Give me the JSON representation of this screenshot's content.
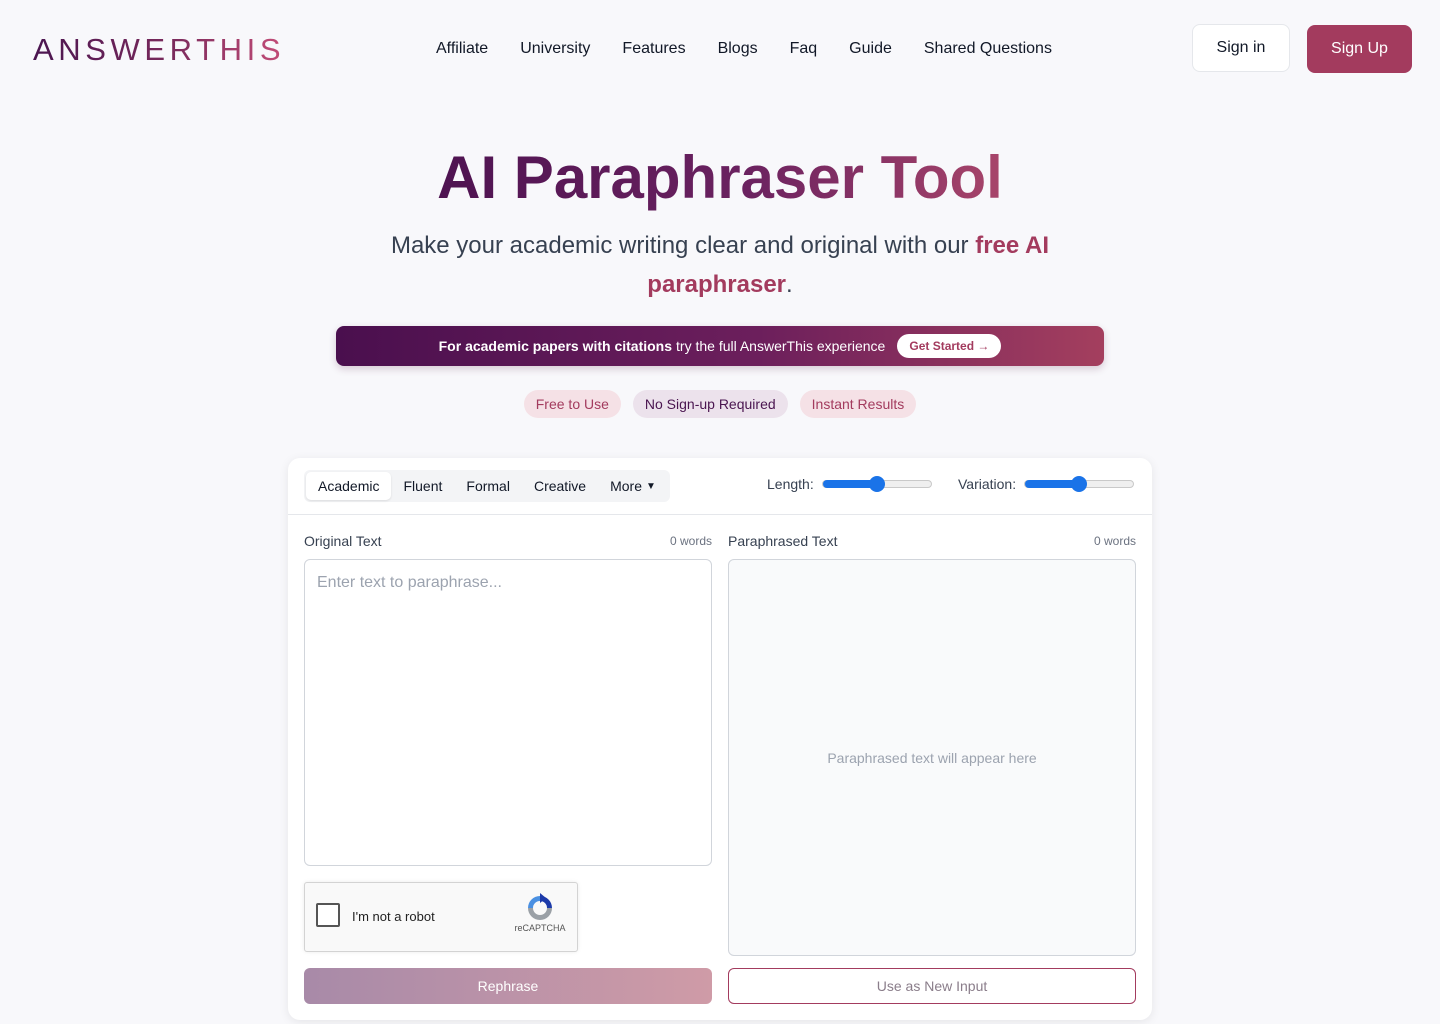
{
  "header": {
    "logo_text": "ANSWERTHIS",
    "nav": [
      "Affiliate",
      "University",
      "Features",
      "Blogs",
      "Faq",
      "Guide",
      "Shared Questions"
    ],
    "sign_in": "Sign in",
    "sign_up": "Sign Up"
  },
  "hero": {
    "title": "AI Paraphraser Tool",
    "subtitle_before": "Make your academic writing clear and original with our ",
    "subtitle_highlight": "free AI paraphraser",
    "subtitle_after": "."
  },
  "banner": {
    "bold_text": "For academic papers with citations",
    "text": "try the full AnswerThis experience",
    "cta": "Get Started →"
  },
  "badges": [
    "Free to Use",
    "No Sign-up Required",
    "Instant Results"
  ],
  "tool": {
    "modes": [
      "Academic",
      "Fluent",
      "Formal",
      "Creative"
    ],
    "more_label": "More",
    "active_mode": "Academic",
    "length_label": "Length:",
    "length_value": 0.5,
    "variation_label": "Variation:",
    "variation_value": 0.5,
    "original_label": "Original Text",
    "original_count": "0 words",
    "original_placeholder": "Enter text to paraphrase...",
    "paraphrased_label": "Paraphrased Text",
    "paraphrased_count": "0 words",
    "output_placeholder": "Paraphrased text will appear here",
    "captcha_text": "I'm not a robot",
    "captcha_brand": "reCAPTCHA",
    "rephrase_button": "Rephrase",
    "use_input_button": "Use as New Input"
  },
  "colors": {
    "brand": "#a33b5e",
    "brand_dark": "#4a1550",
    "slider": "#1a73e8"
  }
}
